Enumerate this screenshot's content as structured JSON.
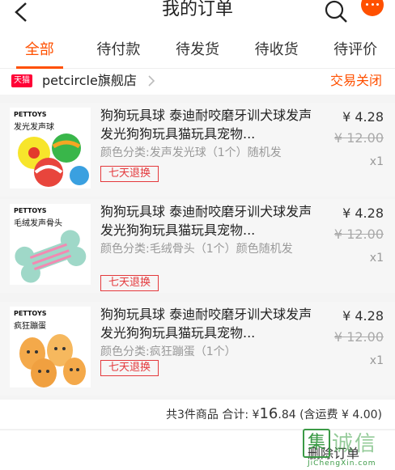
{
  "header": {
    "title": "我的订单"
  },
  "tabs": [
    {
      "label": "全部"
    },
    {
      "label": "待付款"
    },
    {
      "label": "待发货"
    },
    {
      "label": "待收货"
    },
    {
      "label": "待评价"
    }
  ],
  "shop": {
    "badge": "天猫",
    "name": "petcircle旗舰店",
    "status": "交易关闭"
  },
  "items": [
    {
      "thumb_brand": "PETTOYS",
      "thumb_label": "发光发声球",
      "title": "狗狗玩具球 泰迪耐咬磨牙训犬球发声发光狗狗玩具猫玩具宠物...",
      "spec": "颜色分类:发声发光球（1个）随机发",
      "return_tag": "七天退换",
      "price": "¥ 4.28",
      "original_price": "¥ 12.00",
      "quantity": "x1"
    },
    {
      "thumb_brand": "PETTOYS",
      "thumb_label": "毛绒发声骨头",
      "title": "狗狗玩具球 泰迪耐咬磨牙训犬球发声发光狗狗玩具猫玩具宠物...",
      "spec": "颜色分类:毛绒骨头（1个）颜色随机发",
      "return_tag": "七天退换",
      "price": "¥ 4.28",
      "original_price": "¥ 12.00",
      "quantity": "x1"
    },
    {
      "thumb_brand": "PETTOYS",
      "thumb_label": "疯狂蹦蛋",
      "title": "狗狗玩具球 泰迪耐咬磨牙训犬球发声发光狗狗玩具猫玩具宠物...",
      "spec": "颜色分类:疯狂蹦蛋（1个）",
      "return_tag": "七天退换",
      "price": "¥ 4.28",
      "original_price": "¥ 12.00",
      "quantity": "x1"
    }
  ],
  "summary": {
    "count_text": "共3件商品",
    "total_label": "合计: ¥",
    "total_int": "16",
    "total_dec": ".84",
    "shipping": "(含运费 ¥ 4.00)"
  },
  "footer": {
    "delete_label": "删除订单"
  },
  "watermark": {
    "char": "集",
    "text": "诚信",
    "url": "JiChengXin.com"
  },
  "colors": {
    "accent": "#ff5000",
    "tmall": "#ff0036",
    "return_tag": "#e4393c"
  }
}
